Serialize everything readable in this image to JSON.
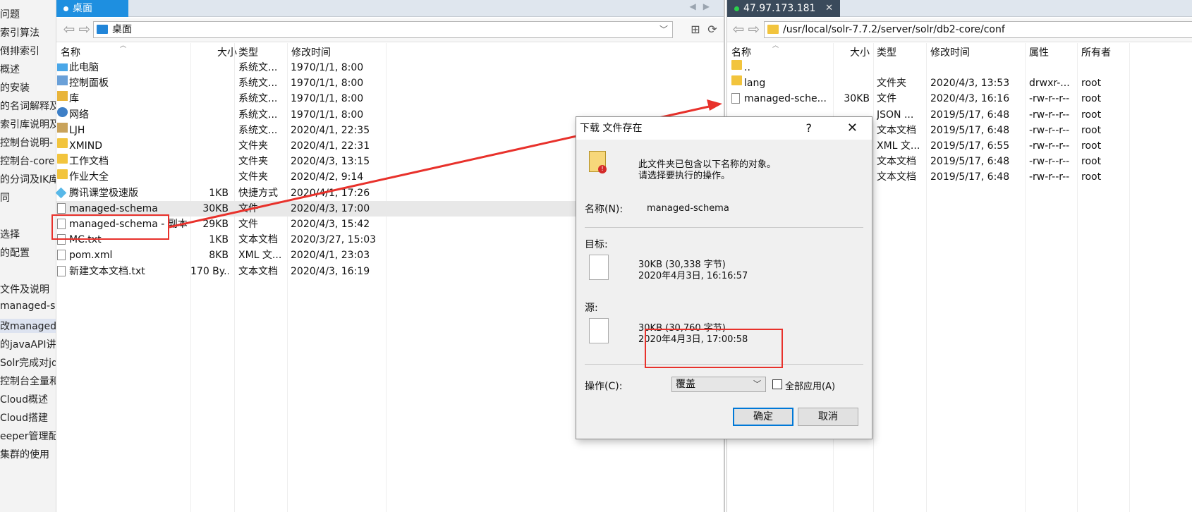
{
  "article_sidebar": {
    "items": [
      {
        "label": "问题"
      },
      {
        "label": "索引算法"
      },
      {
        "label": "倒排索引"
      },
      {
        "label": "概述"
      },
      {
        "label": "的安装"
      },
      {
        "label": "的名词解释及"
      },
      {
        "label": "索引库说明及"
      },
      {
        "label": "控制台说明-"
      },
      {
        "label": "控制台-core"
      },
      {
        "label": "的分词及IK库"
      },
      {
        "label": "同"
      },
      {
        "label": "选择"
      },
      {
        "label": "的配置"
      },
      {
        "label": "文件及说明"
      },
      {
        "label": "managed-sa"
      },
      {
        "label": "改managed-"
      },
      {
        "label": "的javaAPI讲解"
      },
      {
        "label": "Solr完成对jd"
      },
      {
        "label": "控制台全量和"
      },
      {
        "label": "Cloud概述"
      },
      {
        "label": "Cloud搭建"
      },
      {
        "label": "eeper管理配"
      },
      {
        "label": "集群的使用"
      }
    ]
  },
  "left_pane": {
    "tab_label": "桌面",
    "address": "桌面",
    "columns": {
      "name": "名称",
      "size": "大小",
      "type": "类型",
      "modified": "修改时间"
    },
    "rows": [
      {
        "name": "此电脑",
        "size": "",
        "type": "系统文...",
        "modified": "1970/1/1, 8:00",
        "icon": "computer-icon"
      },
      {
        "name": "控制面板",
        "size": "",
        "type": "系统文...",
        "modified": "1970/1/1, 8:00",
        "icon": "control-panel-icon"
      },
      {
        "name": "库",
        "size": "",
        "type": "系统文...",
        "modified": "1970/1/1, 8:00",
        "icon": "library-icon"
      },
      {
        "name": "网络",
        "size": "",
        "type": "系统文...",
        "modified": "1970/1/1, 8:00",
        "icon": "network-icon"
      },
      {
        "name": "LJH",
        "size": "",
        "type": "系统文...",
        "modified": "2020/4/1, 22:35",
        "icon": "user-folder-icon"
      },
      {
        "name": "XMIND",
        "size": "",
        "type": "文件夹",
        "modified": "2020/4/1, 22:31",
        "icon": "folder-icon"
      },
      {
        "name": "工作文档",
        "size": "",
        "type": "文件夹",
        "modified": "2020/4/3, 13:15",
        "icon": "folder-icon"
      },
      {
        "name": "作业大全",
        "size": "",
        "type": "文件夹",
        "modified": "2020/4/2, 9:14",
        "icon": "folder-icon"
      },
      {
        "name": "腾讯课堂极速版",
        "size": "1KB",
        "type": "快捷方式",
        "modified": "2020/4/1, 17:26",
        "icon": "shortcut-icon"
      },
      {
        "name": "managed-schema",
        "size": "30KB",
        "type": "文件",
        "modified": "2020/4/3, 17:00",
        "icon": "file-icon"
      },
      {
        "name": "managed-schema - 副本",
        "size": "29KB",
        "type": "文件",
        "modified": "2020/4/3, 15:42",
        "icon": "file-icon"
      },
      {
        "name": "MC.txt",
        "size": "1KB",
        "type": "文本文档",
        "modified": "2020/3/27, 15:03",
        "icon": "file-icon"
      },
      {
        "name": "pom.xml",
        "size": "8KB",
        "type": "XML 文...",
        "modified": "2020/4/1, 23:03",
        "icon": "file-icon"
      },
      {
        "name": "新建文本文档.txt",
        "size": "170 By...",
        "type": "文本文档",
        "modified": "2020/4/3, 16:19",
        "icon": "file-icon"
      }
    ]
  },
  "right_pane": {
    "tab_label": "47.97.173.181",
    "address": "/usr/local/solr-7.7.2/server/solr/db2-core/conf",
    "columns": {
      "name": "名称",
      "size": "大小",
      "type": "类型",
      "modified": "修改时间",
      "attributes": "属性",
      "owner": "所有者"
    },
    "rows": [
      {
        "name": "..",
        "size": "",
        "type": "",
        "modified": "",
        "attributes": "",
        "owner": "",
        "icon": "folder-icon"
      },
      {
        "name": "lang",
        "size": "",
        "type": "文件夹",
        "modified": "2020/4/3, 13:53",
        "attributes": "drwxr-...",
        "owner": "root",
        "icon": "folder-icon"
      },
      {
        "name": "managed-sche...",
        "size": "30KB",
        "type": "文件",
        "modified": "2020/4/3, 16:16",
        "attributes": "-rw-r--r--",
        "owner": "root",
        "icon": "file-icon"
      },
      {
        "name": "",
        "size": "",
        "type": "JSON ...",
        "modified": "2019/5/17, 6:48",
        "attributes": "-rw-r--r--",
        "owner": "root",
        "icon": ""
      },
      {
        "name": "",
        "size": "",
        "type": "文本文档",
        "modified": "2019/5/17, 6:48",
        "attributes": "-rw-r--r--",
        "owner": "root",
        "icon": ""
      },
      {
        "name": "",
        "size": "",
        "type": "XML 文...",
        "modified": "2019/5/17, 6:55",
        "attributes": "-rw-r--r--",
        "owner": "root",
        "icon": ""
      },
      {
        "name": "",
        "size": "",
        "type": "文本文档",
        "modified": "2019/5/17, 6:48",
        "attributes": "-rw-r--r--",
        "owner": "root",
        "icon": ""
      },
      {
        "name": "",
        "size": "",
        "type": "文本文档",
        "modified": "2019/5/17, 6:48",
        "attributes": "-rw-r--r--",
        "owner": "root",
        "icon": ""
      }
    ]
  },
  "dialog": {
    "title": "下载 文件存在",
    "help": "?",
    "close": "✕",
    "message_line1": "此文件夹已包含以下名称的对象。",
    "message_line2": "请选择要执行的操作。",
    "name_label": "名称(N):",
    "name_value": "managed-schema",
    "target_label": "目标:",
    "target_size": "30KB (30,338 字节)",
    "target_date": "2020年4月3日, 16:16:57",
    "source_label": "源:",
    "source_size": "30KB (30,760 字节)",
    "source_date": "2020年4月3日, 17:00:58",
    "action_label": "操作(C):",
    "action_value": "覆盖",
    "apply_all_label": "全部应用(A)",
    "ok_label": "确定",
    "cancel_label": "取消"
  },
  "colors": {
    "annotation": "#e8312b",
    "left_tab": "#1e8fe0",
    "right_tab": "#3a4a5b"
  }
}
